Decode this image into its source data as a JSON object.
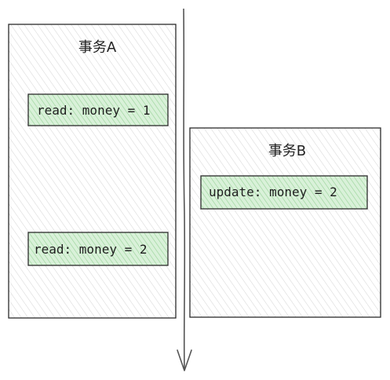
{
  "colors": {
    "box_stroke": "#2b2b2b",
    "box_hatch": "#d0d0d0",
    "op_fill": "#cfeccf",
    "op_hatch": "#8fcf8f",
    "op_stroke": "#2b2b2b",
    "timeline": "#555555"
  },
  "transaction_a": {
    "title": "事务A",
    "operations": [
      {
        "label": "read: money = 1"
      },
      {
        "label": "read: money = 2"
      }
    ]
  },
  "transaction_b": {
    "title": "事务B",
    "operations": [
      {
        "label": "update: money = 2"
      }
    ]
  },
  "timeline": {
    "direction": "down",
    "arrow_icon": "arrow-down-icon"
  }
}
